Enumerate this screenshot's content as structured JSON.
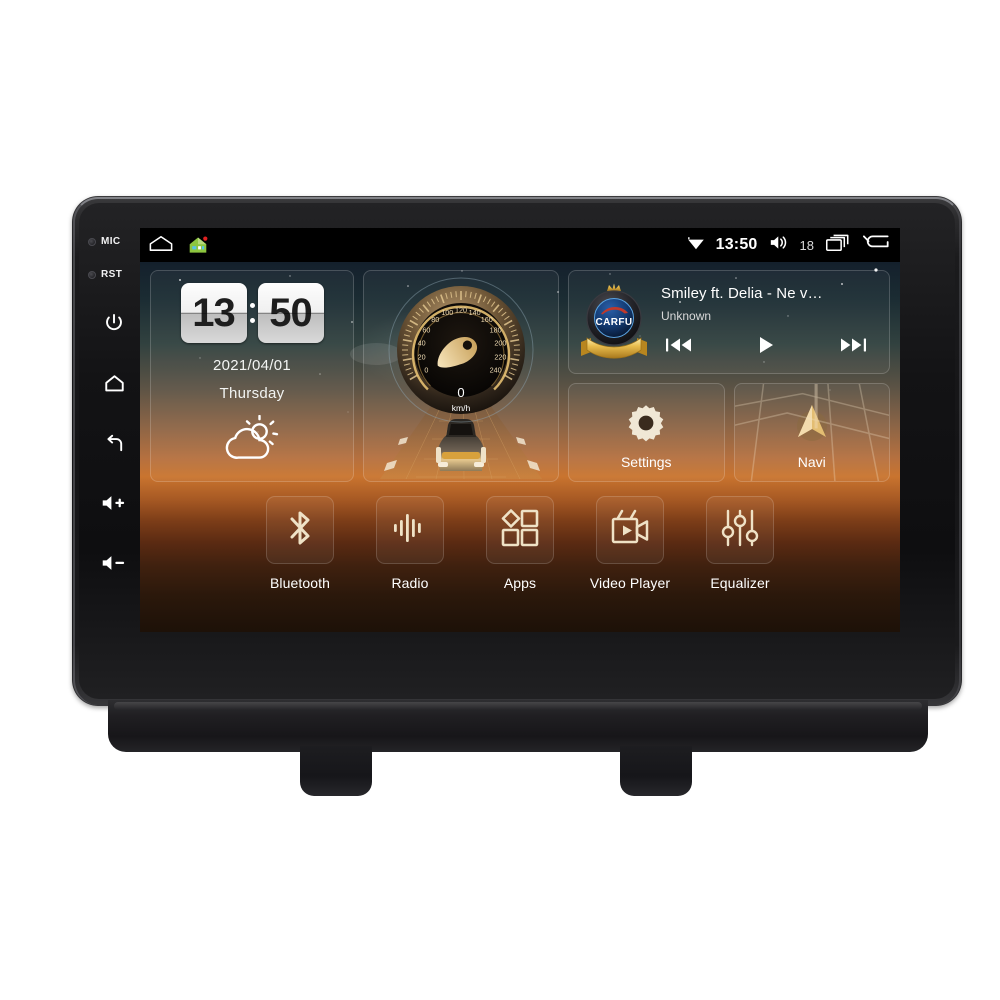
{
  "device": {
    "bezel_left": {
      "indicators": [
        {
          "name": "mic-indicator",
          "label": "MIC"
        },
        {
          "name": "reset-indicator",
          "label": "RST"
        }
      ],
      "buttons": [
        {
          "name": "power-button",
          "icon": "power-icon"
        },
        {
          "name": "home-button",
          "icon": "home-icon"
        },
        {
          "name": "back-button",
          "icon": "back-arrow-icon"
        },
        {
          "name": "volume-up-button",
          "icon": "volume-up-icon"
        },
        {
          "name": "volume-down-button",
          "icon": "volume-down-icon"
        }
      ]
    }
  },
  "statusbar": {
    "left_icons": [
      {
        "name": "home-outline-icon",
        "label": "home-outline-icon"
      },
      {
        "name": "house-app-icon",
        "label": "house-app-icon"
      }
    ],
    "wifi_icon": "wifi-icon",
    "clock": "13:50",
    "volume_icon": "volume-icon",
    "volume_level": "18",
    "recents_icon": "recent-apps-icon",
    "back_icon": "back-arrow-icon"
  },
  "widgets": {
    "clock": {
      "hours": "13",
      "minutes": "50",
      "date": "2021/04/01",
      "weekday": "Thursday",
      "weather_icon": "partly-cloudy-icon"
    },
    "gauge": {
      "speed_value": "0",
      "unit": "km/h",
      "ticks": [
        "0",
        "20",
        "40",
        "60",
        "80",
        "100",
        "120",
        "140",
        "160",
        "180",
        "200",
        "220",
        "240"
      ],
      "min": 0,
      "max": 240,
      "needle_value": 0,
      "accent_color": "#e8c98a"
    },
    "media": {
      "logo_text": "CARFU",
      "logo_icon": "carfu-badge-icon",
      "track_title": "Smiley ft. Delia - Ne v…",
      "artist": "Unknown",
      "controls": [
        {
          "name": "previous-track-button",
          "icon": "skip-previous-icon"
        },
        {
          "name": "play-button",
          "icon": "play-icon"
        },
        {
          "name": "next-track-button",
          "icon": "skip-next-icon"
        }
      ]
    },
    "tiles": [
      {
        "name": "settings-tile",
        "label": "Settings",
        "icon": "gear-icon"
      },
      {
        "name": "navi-tile",
        "label": "Navi",
        "icon": "navigation-arrow-icon"
      }
    ]
  },
  "dock": {
    "items": [
      {
        "name": "bluetooth-app",
        "label": "Bluetooth",
        "icon": "bluetooth-icon"
      },
      {
        "name": "radio-app",
        "label": "Radio",
        "icon": "radio-waves-icon"
      },
      {
        "name": "apps-app",
        "label": "Apps",
        "icon": "apps-grid-icon"
      },
      {
        "name": "video-player-app",
        "label": "Video Player",
        "icon": "video-camera-icon"
      },
      {
        "name": "equalizer-app",
        "label": "Equalizer",
        "icon": "equalizer-sliders-icon"
      }
    ]
  },
  "colors": {
    "accent_gold": "#e8c98a",
    "screen_black": "#000000",
    "bezel_black": "#141416",
    "logo_blue": "#123a75",
    "logo_red": "#c0392b",
    "ribbon_gold": "#e7b84a"
  }
}
